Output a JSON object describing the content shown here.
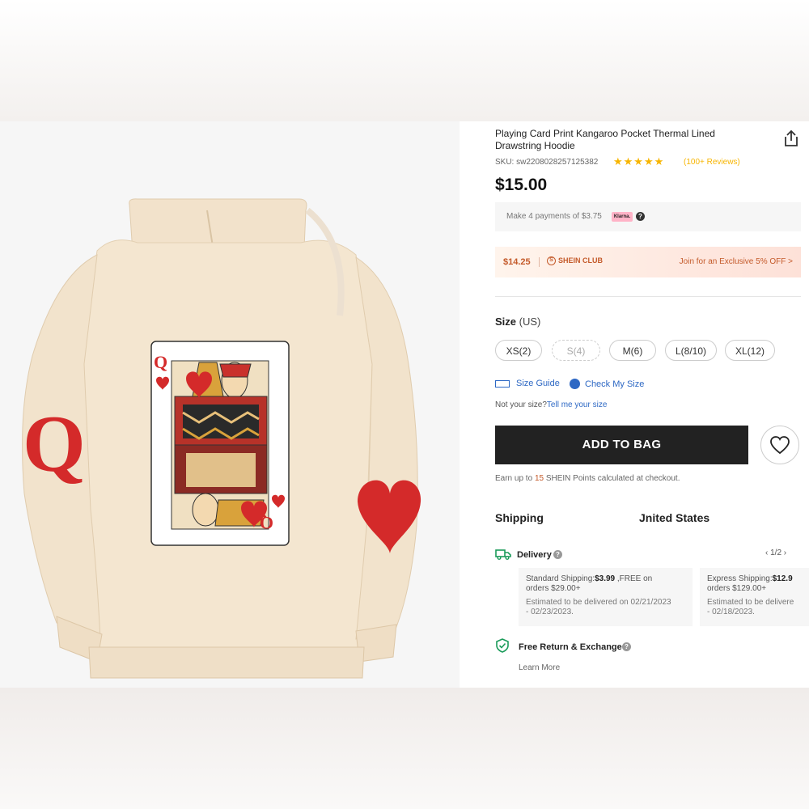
{
  "product": {
    "title": "Playing Card Print Kangaroo Pocket Thermal Lined Drawstring Hoodie",
    "sku": "SKU: sw2208028257125382",
    "rating_stars": "★★★★★",
    "reviews": "(100+ Reviews)",
    "price": "$15.00"
  },
  "klarna": {
    "text": "Make 4 payments of $3.75",
    "badge": "Klarna.",
    "help": "?"
  },
  "club": {
    "price": "$14.25",
    "logo": "SHEIN CLUB",
    "join": "Join for an Exclusive 5% OFF >"
  },
  "size": {
    "label": "Size",
    "unit": "(US)",
    "options": [
      {
        "label": "XS(2)",
        "available": true
      },
      {
        "label": "S(4)",
        "available": false
      },
      {
        "label": "M(6)",
        "available": true
      },
      {
        "label": "L(8/10)",
        "available": true
      },
      {
        "label": "XL(12)",
        "available": true
      }
    ],
    "guide": "Size Guide",
    "check": "Check My Size",
    "not_size": "Not your size?",
    "tell_me": "Tell me your size"
  },
  "cart": {
    "add_to_bag": "ADD TO BAG",
    "points_prefix": "Earn up to",
    "points_num": "15",
    "points_suffix": "SHEIN Points calculated at checkout."
  },
  "shipping": {
    "label": "Shipping",
    "country": "Jnited States",
    "delivery": "Delivery",
    "help": "?",
    "pager": "‹  1/2  ›",
    "standard": {
      "title": "Standard Shipping:",
      "price": "$3.99",
      "free_line1": " ,FREE on",
      "free_line2": "orders $29.00+",
      "est_line1": "Estimated to be delivered on 02/21/2023",
      "est_line2": "- 02/23/2023."
    },
    "express": {
      "title": "Express Shipping:",
      "price": "$12.9",
      "free_line2": "orders $129.00+",
      "est_line1": "Estimated to be delivere",
      "est_line2": "- 02/18/2023."
    }
  },
  "returns": {
    "label": "Free Return & Exchange",
    "help": "?",
    "learn_more": "Learn More"
  },
  "card_art": {
    "rank": "Q",
    "sleeve_letter": "Q"
  },
  "colors": {
    "hoodie": "#f4e6d0",
    "accent_red": "#d42a2a",
    "link_blue": "#2d68c4",
    "star": "#f7b500"
  }
}
